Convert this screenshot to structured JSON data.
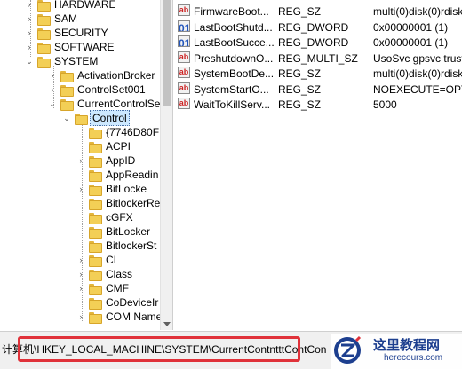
{
  "tree": {
    "nodes": [
      {
        "label": "HARDWARE",
        "expander": "›"
      },
      {
        "label": "SAM",
        "expander": "›"
      },
      {
        "label": "SECURITY",
        "expander": "›"
      },
      {
        "label": "SOFTWARE",
        "expander": "›"
      },
      {
        "label": "SYSTEM",
        "expander": "⌄"
      },
      {
        "label": "ActivationBroker",
        "expander": "›"
      },
      {
        "label": "ControlSet001",
        "expander": "›"
      },
      {
        "label": "CurrentControlSe",
        "expander": "⌄"
      },
      {
        "label": "Control",
        "expander": "⌄"
      },
      {
        "label": "{7746D80F",
        "expander": ""
      },
      {
        "label": "ACPI",
        "expander": ""
      },
      {
        "label": "AppID",
        "expander": "›"
      },
      {
        "label": "AppReadin",
        "expander": ""
      },
      {
        "label": "BitLocke",
        "expander": "›"
      },
      {
        "label": "BitlockerRes",
        "expander": ""
      },
      {
        "label": "cGFX",
        "expander": ""
      },
      {
        "label": "BitLocker",
        "expander": ""
      },
      {
        "label": "BitlockerSt",
        "expander": ""
      },
      {
        "label": "CI",
        "expander": "›"
      },
      {
        "label": "Class",
        "expander": "›"
      },
      {
        "label": "CMF",
        "expander": "›"
      },
      {
        "label": "CoDeviceIr",
        "expander": ""
      },
      {
        "label": "COM Name",
        "expander": "›"
      }
    ]
  },
  "values": [
    {
      "icon": "ab",
      "name": "FirmwareBoot...",
      "type": "REG_SZ",
      "data": "multi(0)disk(0)rdisk"
    },
    {
      "icon": "dword",
      "name": "LastBootShutd...",
      "type": "REG_DWORD",
      "data": "0x00000001 (1)"
    },
    {
      "icon": "dword",
      "name": "LastBootSucce...",
      "type": "REG_DWORD",
      "data": "0x00000001 (1)"
    },
    {
      "icon": "ab",
      "name": "PreshutdownO...",
      "type": "REG_MULTI_SZ",
      "data": "UsoSvc gpsvc trust"
    },
    {
      "icon": "ab",
      "name": "SystemBootDe...",
      "type": "REG_SZ",
      "data": "multi(0)disk(0)rdisk"
    },
    {
      "icon": "ab",
      "name": "SystemStartO...",
      "type": "REG_SZ",
      "data": "NOEXECUTE=OPTI"
    },
    {
      "icon": "ab",
      "name": "WaitToKillServ...",
      "type": "REG_SZ",
      "data": "5000"
    }
  ],
  "status": {
    "path": "计算机\\HKEY_LOCAL_MACHINE\\SYSTEM\\CurrentContntttContCon"
  },
  "watermark": {
    "cn": "这里教程网",
    "en": "herecours.com",
    "brand_color": "#1d3f8f"
  },
  "colors": {
    "highlight_border": "#e0323a",
    "selected_bg": "#cce8ff",
    "folder": "#f3cf56"
  }
}
